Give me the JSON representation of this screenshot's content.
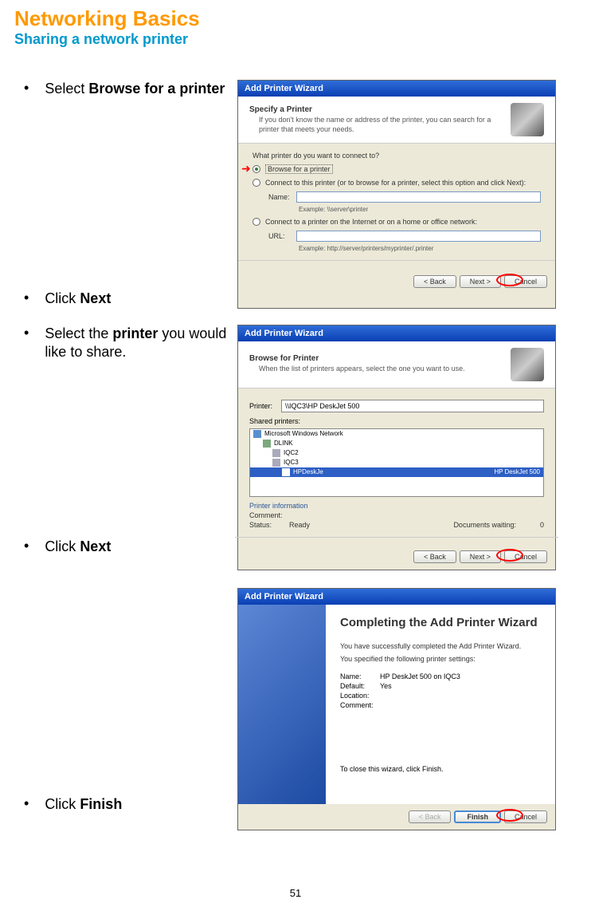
{
  "title": "Networking Basics",
  "subtitle": "Sharing a network printer",
  "instructions": {
    "browse": {
      "prefix": "Select ",
      "bold": "Browse for a printer"
    },
    "next1": {
      "prefix": "Click ",
      "bold": "Next"
    },
    "select_printer": {
      "prefix": "Select the ",
      "bold": "printer",
      "suffix": " you would like to share."
    },
    "next2": {
      "prefix": "Click ",
      "bold": "Next"
    },
    "finish": {
      "prefix": "Click ",
      "bold": "Finish"
    }
  },
  "dialog1": {
    "title": "Add Printer Wizard",
    "header_title": "Specify a Printer",
    "header_sub": "If you don't know the name or address of the printer, you can search for a printer that meets your needs.",
    "prompt": "What printer do you want to connect to?",
    "radio1": "Browse for a printer",
    "radio2": "Connect to this printer (or to browse for a printer, select this option and click Next):",
    "name_label": "Name:",
    "example1": "Example: \\\\server\\printer",
    "radio3": "Connect to a printer on the Internet or on a home or office network:",
    "url_label": "URL:",
    "example2": "Example: http://server/printers/myprinter/.printer",
    "back": "< Back",
    "next": "Next >",
    "cancel": "Cancel"
  },
  "dialog2": {
    "title": "Add Printer Wizard",
    "header_title": "Browse for Printer",
    "header_sub": "When the list of printers appears, select the one you want to use.",
    "printer_label": "Printer:",
    "printer_value": "\\\\IQC3\\HP DeskJet 500",
    "shared_label": "Shared printers:",
    "tree": {
      "network": "Microsoft Windows Network",
      "workgroup": "DLINK",
      "pc1": "IQC2",
      "pc2": "IQC3",
      "printer_item": "HPDeskJe",
      "printer_desc": "HP DeskJet 500"
    },
    "info_header": "Printer information",
    "comment_label": "Comment:",
    "status_label": "Status:",
    "status_value": "Ready",
    "docs_label": "Documents waiting:",
    "docs_value": "0",
    "back": "< Back",
    "next": "Next >",
    "cancel": "Cancel"
  },
  "dialog3": {
    "title": "Add Printer Wizard",
    "completing": "Completing the Add Printer Wizard",
    "summary1": "You have successfully completed the Add Printer Wizard.",
    "summary2": "You specified the following printer settings:",
    "name_label": "Name:",
    "name_value": "HP DeskJet 500 on IQC3",
    "default_label": "Default:",
    "default_value": "Yes",
    "location_label": "Location:",
    "comment_label": "Comment:",
    "close_text": "To close this wizard, click Finish.",
    "back": "< Back",
    "finish": "Finish",
    "cancel": "Cancel"
  },
  "page_number": "51"
}
